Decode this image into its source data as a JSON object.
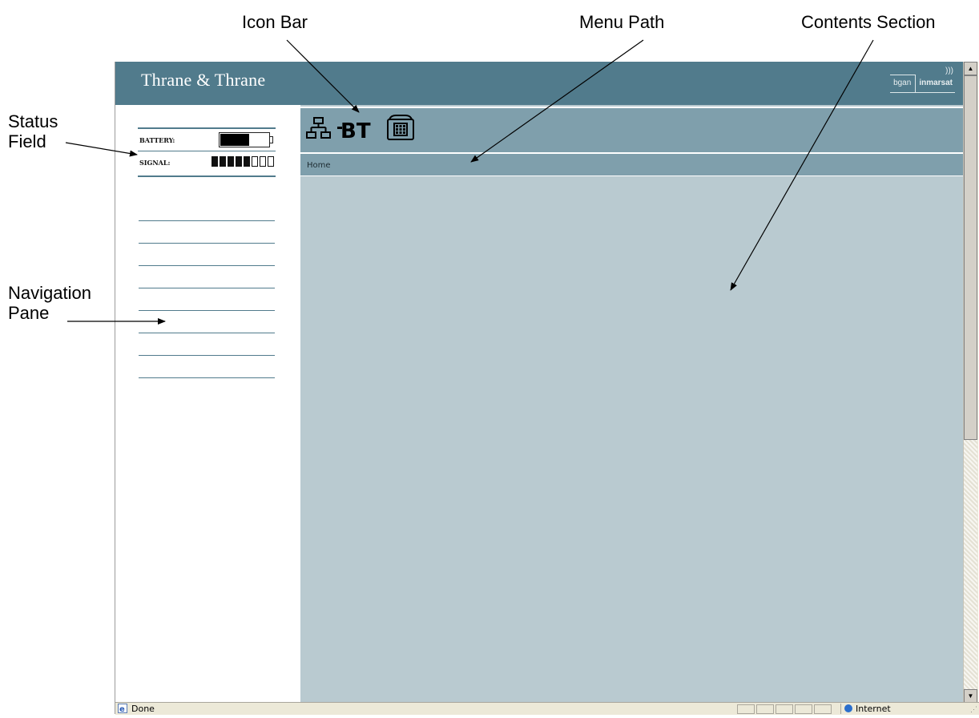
{
  "callouts": {
    "icon_bar": "Icon Bar",
    "menu_path": "Menu Path",
    "contents_section": "Contents Section",
    "status_field_line1": "Status",
    "status_field_line2": "Field",
    "navigation_pane_line1": "Navigation",
    "navigation_pane_line2": "Pane"
  },
  "header": {
    "brand": "Thrane & Thrane",
    "logo_bgan": "bgan",
    "logo_inmarsat": "inmarsat"
  },
  "status": {
    "battery_label": "BATTERY:",
    "battery_level": 0.6,
    "signal_label": "SIGNAL:",
    "signal_bars_on": 5,
    "signal_bars_total": 8
  },
  "icon_bar": {
    "icons": [
      "network-icon",
      "bluetooth-bt-icon",
      "phone-icon"
    ],
    "bt_text": "BT"
  },
  "menu_path": {
    "text": "Home"
  },
  "navigation": {
    "item_count": 8
  },
  "browser_status": {
    "text": "Done",
    "zone": "Internet"
  },
  "colors": {
    "header": "#517b8c",
    "icon_bar": "#7f9fac",
    "contents": "#b9cad0"
  }
}
